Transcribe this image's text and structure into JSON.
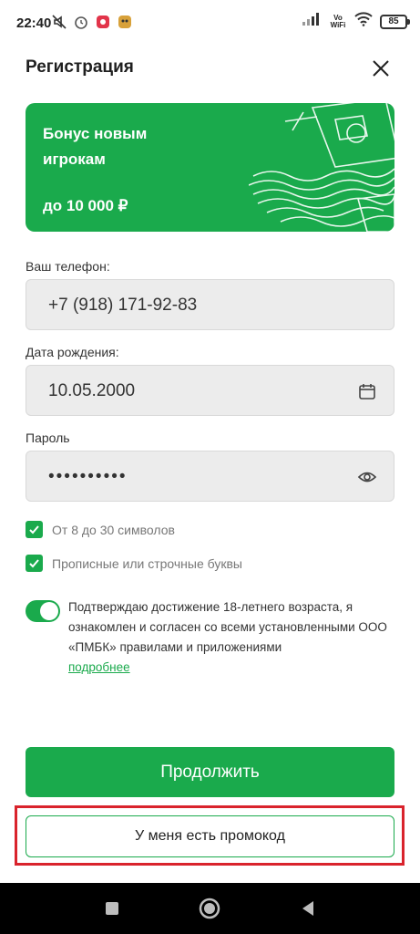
{
  "status_bar": {
    "time": "22:40",
    "vowifi_line1": "Vo",
    "vowifi_line2": "WiFi",
    "battery": "85"
  },
  "header": {
    "title": "Регистрация",
    "close_icon": "close-icon"
  },
  "banner": {
    "title": "Бонус новым игрокам",
    "amount": "до 10 000 ₽"
  },
  "form": {
    "phone_label": "Ваш телефон:",
    "phone_value": "+7 (918) 171-92-83",
    "birth_label": "Дата рождения:",
    "birth_value": "10.05.2000",
    "birth_icon": "calendar-icon",
    "password_label": "Пароль",
    "password_value": "••••••••••",
    "password_icon": "eye-icon"
  },
  "checks": [
    {
      "label": "От 8 до 30 символов",
      "checked": true
    },
    {
      "label": "Прописные или строчные буквы",
      "checked": true
    }
  ],
  "consent": {
    "text": "Подтверждаю достижение 18-летнего возраста, я ознакомлен и согласен со всеми установленными ООО «ПМБК» правилами и приложениями",
    "link": "подробнее",
    "enabled": true
  },
  "buttons": {
    "continue": "Продолжить",
    "promo": "У меня есть промокод"
  },
  "colors": {
    "brand_green": "#1aaa4c",
    "highlight_red": "#d9232c"
  }
}
